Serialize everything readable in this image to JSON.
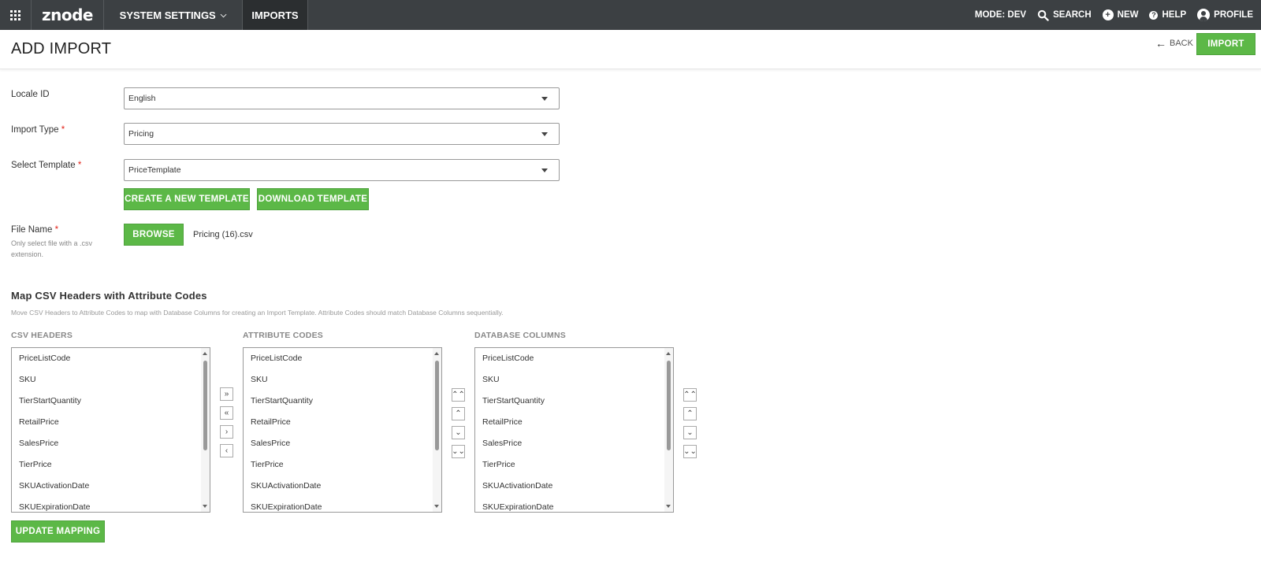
{
  "topbar": {
    "logo": "znode",
    "menus": [
      {
        "label": "SYSTEM SETTINGS"
      },
      {
        "label": "IMPORTS"
      }
    ],
    "mode": "MODE: DEV",
    "search": "SEARCH",
    "new": "NEW",
    "help": "HELP",
    "profile": "PROFILE"
  },
  "header": {
    "title": "ADD IMPORT",
    "back": "BACK",
    "import_button": "IMPORT"
  },
  "form": {
    "locale": {
      "label": "Locale ID",
      "value": "English"
    },
    "import_type": {
      "label": "Import Type",
      "value": "Pricing"
    },
    "template": {
      "label": "Select Template",
      "value": "PriceTemplate"
    },
    "create_template": "CREATE A NEW TEMPLATE",
    "download_template": "DOWNLOAD TEMPLATE",
    "file": {
      "label": "File Name",
      "hint": "Only select file with a .csv extension.",
      "browse": "BROWSE",
      "filename": "Pricing (16).csv"
    },
    "required_marker": "*"
  },
  "mapping": {
    "title": "Map CSV Headers with Attribute Codes",
    "description": "Move CSV Headers to Attribute Codes to map with Database Columns for creating an Import Template. Attribute Codes should match Database Columns sequentially.",
    "columns": [
      {
        "heading": "CSV HEADERS",
        "items": [
          "PriceListCode",
          "SKU",
          "TierStartQuantity",
          "RetailPrice",
          "SalesPrice",
          "TierPrice",
          "SKUActivationDate",
          "SKUExpirationDate"
        ]
      },
      {
        "heading": "ATTRIBUTE CODES",
        "items": [
          "PriceListCode",
          "SKU",
          "TierStartQuantity",
          "RetailPrice",
          "SalesPrice",
          "TierPrice",
          "SKUActivationDate",
          "SKUExpirationDate"
        ]
      },
      {
        "heading": "DATABASE COLUMNS",
        "items": [
          "PriceListCode",
          "SKU",
          "TierStartQuantity",
          "RetailPrice",
          "SalesPrice",
          "TierPrice",
          "SKUActivationDate",
          "SKUExpirationDate"
        ]
      }
    ],
    "transfer_buttons": [
      "»",
      "«",
      "›",
      "‹"
    ],
    "order_buttons": [
      "⌃⌃",
      "⌃",
      "⌄",
      "⌄⌄"
    ],
    "update_button": "UPDATE MAPPING"
  },
  "colors": {
    "topbar": "#3c4043",
    "accent_green": "#5cb847",
    "required": "#e2231a"
  }
}
